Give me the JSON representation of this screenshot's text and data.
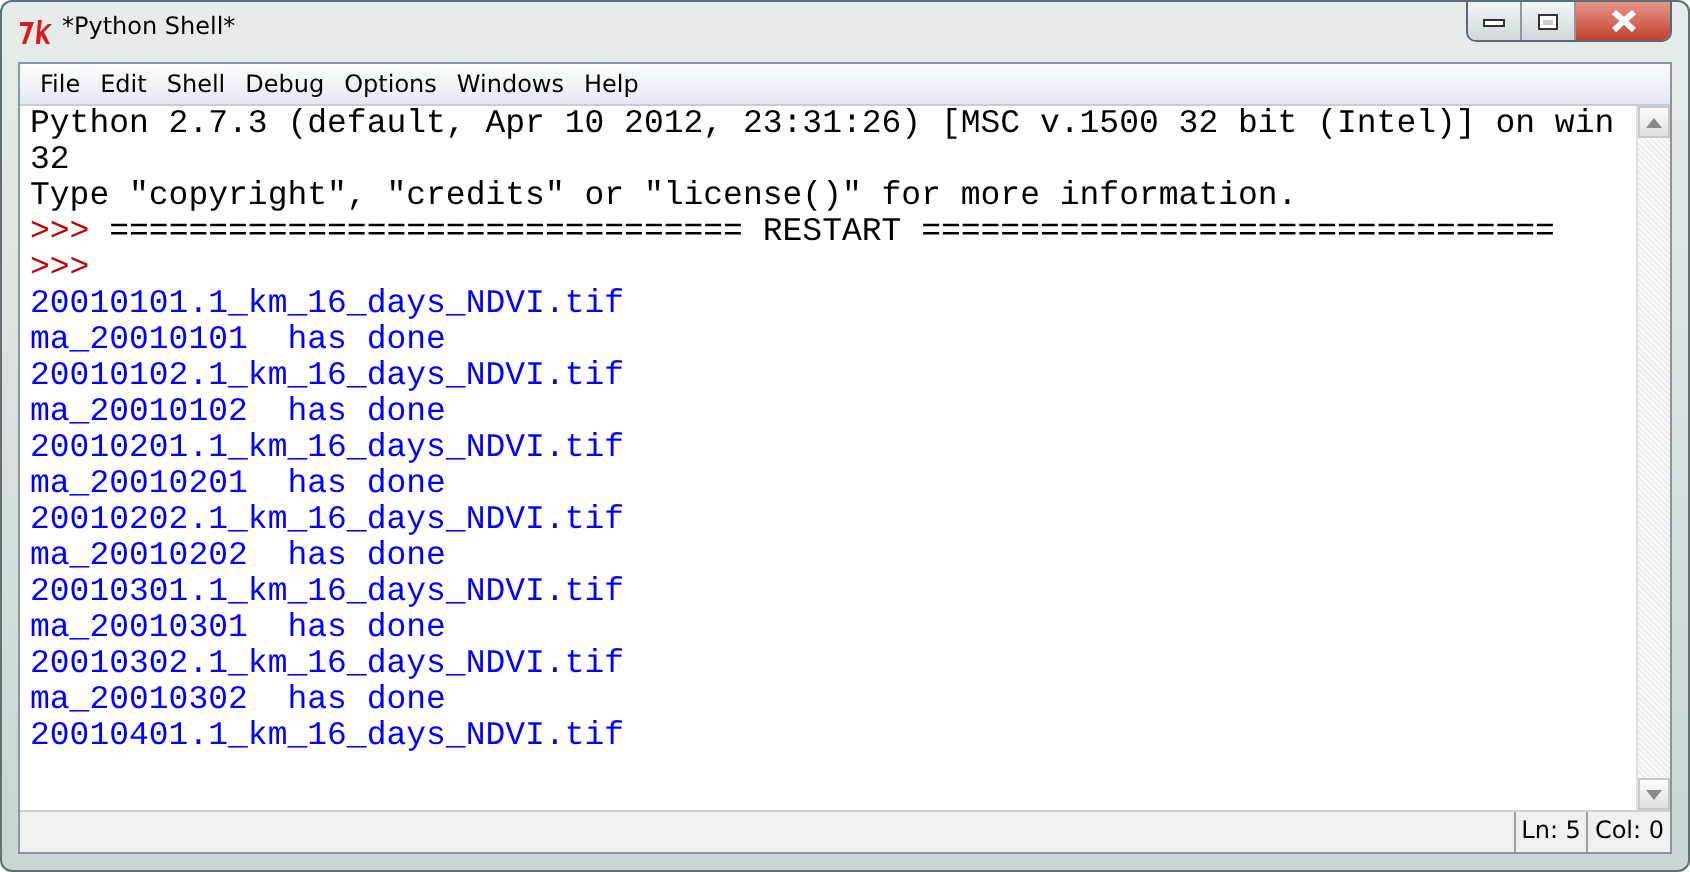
{
  "window": {
    "title": "*Python Shell*"
  },
  "menu": [
    "File",
    "Edit",
    "Shell",
    "Debug",
    "Options",
    "Windows",
    "Help"
  ],
  "lines": [
    {
      "kind": "output",
      "text": "Python 2.7.3 (default, Apr 10 2012, 23:31:26) [MSC v.1500 32 bit (Intel)] on win"
    },
    {
      "kind": "output",
      "text": "32"
    },
    {
      "kind": "output",
      "text": "Type \"copyright\", \"credits\" or \"license()\" for more information."
    },
    {
      "kind": "output",
      "prompt": ">>>",
      "text": "================================ RESTART ================================"
    },
    {
      "kind": "output",
      "prompt": ">>>"
    },
    {
      "kind": "stdout",
      "text": "20010101.1_km_16_days_NDVI.tif"
    },
    {
      "kind": "stdout",
      "text": "ma_20010101  has done"
    },
    {
      "kind": "stdout",
      "text": "20010102.1_km_16_days_NDVI.tif"
    },
    {
      "kind": "stdout",
      "text": "ma_20010102  has done"
    },
    {
      "kind": "stdout",
      "text": "20010201.1_km_16_days_NDVI.tif"
    },
    {
      "kind": "stdout",
      "text": "ma_20010201  has done"
    },
    {
      "kind": "stdout",
      "text": "20010202.1_km_16_days_NDVI.tif"
    },
    {
      "kind": "stdout",
      "text": "ma_20010202  has done"
    },
    {
      "kind": "stdout",
      "text": "20010301.1_km_16_days_NDVI.tif"
    },
    {
      "kind": "stdout",
      "text": "ma_20010301  has done"
    },
    {
      "kind": "stdout",
      "text": "20010302.1_km_16_days_NDVI.tif"
    },
    {
      "kind": "stdout",
      "text": "ma_20010302  has done"
    },
    {
      "kind": "stdout",
      "text": "20010401.1_km_16_days_NDVI.tif"
    }
  ],
  "status_bar": {
    "line": "Ln: 5",
    "column": "Col: 0"
  }
}
